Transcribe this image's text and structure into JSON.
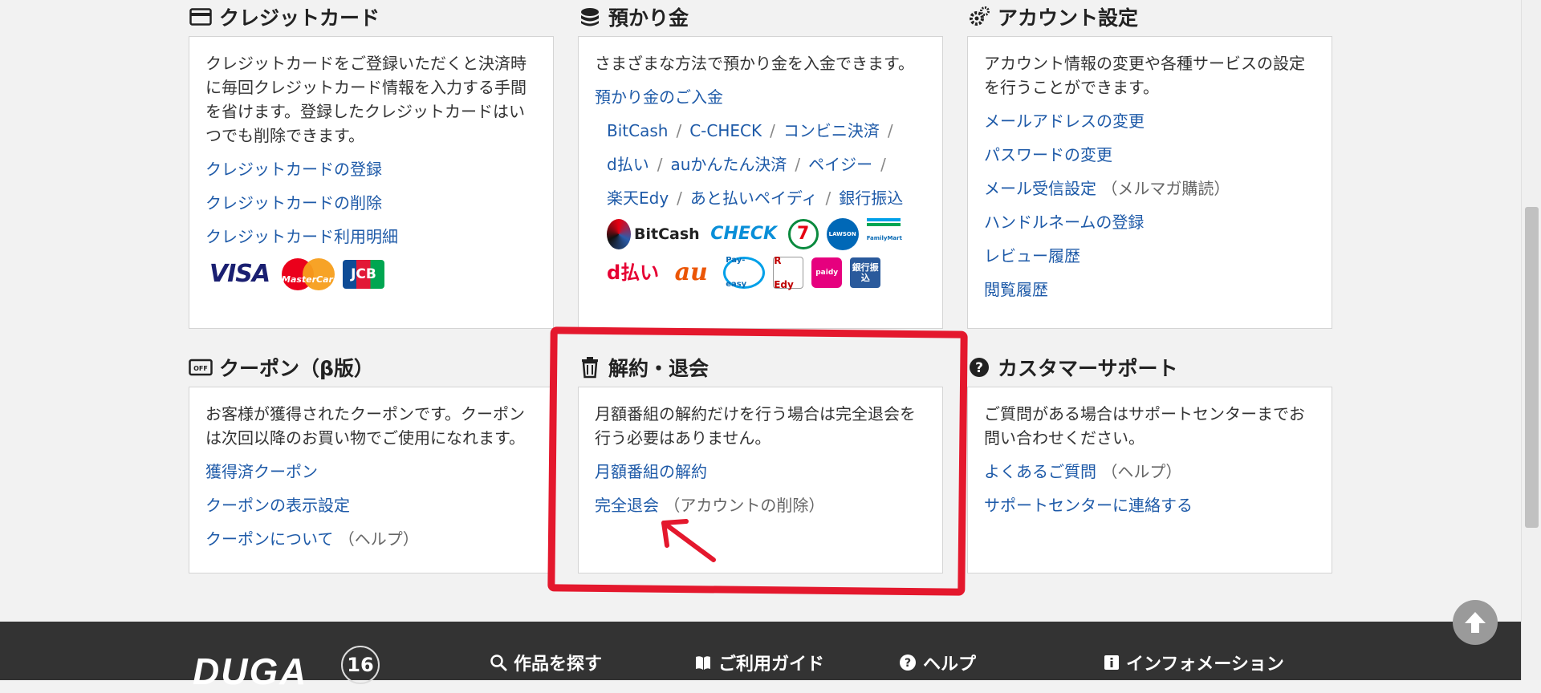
{
  "credit": {
    "title": "クレジットカード",
    "desc": "クレジットカードをご登録いただくと決済時に毎回クレジットカード情報を入力する手間を省けます。登録したクレジットカードはいつでも削除できます。",
    "links": [
      "クレジットカードの登録",
      "クレジットカードの削除",
      "クレジットカード利用明細"
    ],
    "brands": [
      "VISA",
      "MasterCard",
      "JCB"
    ]
  },
  "deposit": {
    "title": "預かり金",
    "desc": "さまざまな方法で預かり金を入金できます。",
    "link": "預かり金のご入金",
    "methods": [
      "BitCash",
      "C-CHECK",
      "コンビニ決済",
      "d払い",
      "auかんたん決済",
      "ペイジー",
      "楽天Edy",
      "あと払いペイディ",
      "銀行振込"
    ],
    "logos_row1": [
      "BitCash",
      "CHECK",
      "7",
      "LAWSON",
      "FamilyMart"
    ],
    "logos_row2": [
      "d払い",
      "au",
      "Pay-easy",
      "R Edy",
      "paidy",
      "銀行振込"
    ]
  },
  "account": {
    "title": "アカウント設定",
    "desc": "アカウント情報の変更や各種サービスの設定を行うことができます。",
    "links": [
      "メールアドレスの変更",
      "パスワードの変更",
      "メール受信設定",
      "ハンドルネームの登録",
      "レビュー履歴",
      "閲覧履歴"
    ],
    "mail_note": "（メルマガ購読）"
  },
  "coupon": {
    "title": "クーポン（β版）",
    "desc": "お客様が獲得されたクーポンです。クーポンは次回以降のお買い物でご使用になれます。",
    "links": [
      "獲得済クーポン",
      "クーポンの表示設定",
      "クーポンについて"
    ],
    "help_note": "（ヘルプ）"
  },
  "cancel": {
    "title": "解約・退会",
    "desc": "月額番組の解約だけを行う場合は完全退会を行う必要はありません。",
    "links": [
      "月額番組の解約",
      "完全退会"
    ],
    "delete_note": "（アカウントの削除）"
  },
  "support": {
    "title": "カスタマーサポート",
    "desc": "ご質問がある場合はサポートセンターまでお問い合わせください。",
    "links": [
      "よくあるご質問",
      "サポートセンターに連絡する"
    ],
    "help_note": "（ヘルプ）"
  },
  "footer": {
    "logo": "DUGA",
    "anniversary": "16",
    "items": [
      "作品を探す",
      "ご利用ガイド",
      "ヘルプ",
      "インフォメーション"
    ]
  },
  "colors": {
    "link": "#1e5aa8",
    "annotation": "#e4182d",
    "footer_bg": "#333333"
  }
}
